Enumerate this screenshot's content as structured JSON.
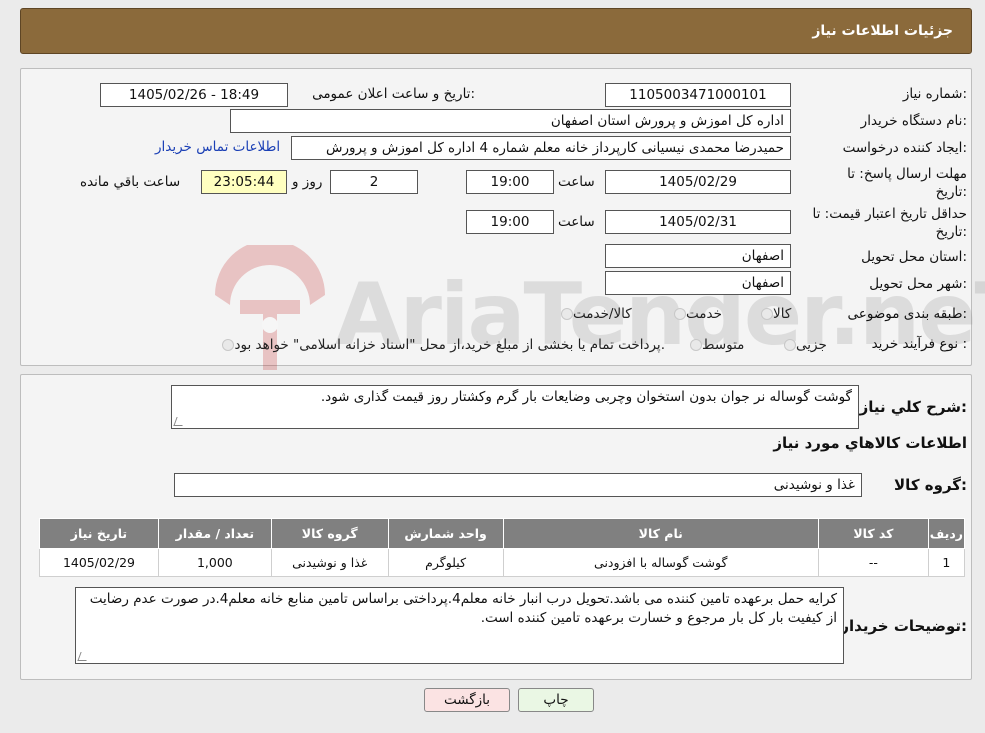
{
  "header": {
    "title": "جزئیات اطلاعات نیاز"
  },
  "watermark": {
    "text": "AriaTender.neT"
  },
  "form": {
    "need_number": {
      "label": "شماره نیاز:",
      "value": "1105003471000101"
    },
    "announce": {
      "label": "تاریخ و ساعت اعلان عمومی:",
      "value": "1405/02/26 - 18:49"
    },
    "buyer_org": {
      "label": "نام دستگاه خریدار:",
      "value": "اداره کل اموزش و پرورش استان اصفهان"
    },
    "requester": {
      "label": "ایجاد کننده درخواست:",
      "value": "حمیدرضا محمدی نیسیانی کارپرداز خانه معلم شماره 4 اداره کل اموزش و پرورش",
      "contact_link": "اطلاعات تماس خریدار"
    },
    "deadline": {
      "label_line1": "مهلت ارسال پاسخ: تا",
      "label_line2": "تاریخ:",
      "date": "1405/02/29",
      "time_label": "ساعت",
      "time": "19:00",
      "days": "2",
      "days_label": "روز و",
      "remaining": "23:05:44",
      "remaining_label": "ساعت باقي مانده"
    },
    "min_validity": {
      "label_line1": "حداقل تاریخ اعتبار قیمت: تا",
      "label_line2": "تاریخ:",
      "date": "1405/02/31",
      "time_label": "ساعت",
      "time": "19:00"
    },
    "province": {
      "label": "استان محل تحویل:",
      "value": "اصفهان"
    },
    "city": {
      "label": "شهر محل تحویل:",
      "value": "اصفهان"
    },
    "category": {
      "label": "طبقه بندی موضوعی:",
      "options": [
        "کالا",
        "خدمت",
        "کالا/خدمت"
      ]
    },
    "process": {
      "label": "نوع فرآیند خرید :",
      "options": [
        "جزیی",
        "متوسط"
      ],
      "note": "پرداخت تمام یا بخشی از مبلغ خرید،از محل \"اسناد خزانه اسلامی\" خواهد بود."
    }
  },
  "description": {
    "label": "شرح کلي نياز:",
    "value": "گوشت گوساله نر جوان بدون استخوان وچربی  وضایعات بار گرم وکشتار روز قیمت گذاری شود."
  },
  "goods": {
    "title": "اطلاعات کالاهاي مورد نياز",
    "group_label": "گروه کالا:",
    "group_value": "غذا و نوشیدنی",
    "columns": [
      "رديف",
      "کد کالا",
      "نام کالا",
      "واحد شمارش",
      "گروه کالا",
      "تعداد / مقدار",
      "تاریخ نیاز"
    ],
    "rows": [
      [
        "1",
        "--",
        "گوشت گوساله با افزودنی",
        "کیلوگرم",
        "غذا و نوشیدنی",
        "1,000",
        "1405/02/29"
      ]
    ]
  },
  "buyer_notes": {
    "label": "توضیحات خریدار:",
    "value": "کرایه حمل برعهده تامین کننده می باشد.تحویل درب انبار خانه معلم4.پرداختی براساس تامین منابع خانه معلم4.در صورت عدم رضایت از کیفیت بار کل بار مرجوع و خسارت برعهده تامین کننده است."
  },
  "buttons": {
    "print": "چاپ",
    "back": "بازگشت"
  },
  "colors": {
    "header_bg": "#8b6a3b",
    "table_header_bg": "#808080",
    "back_button_bg": "#fbe3e3",
    "print_button_bg": "#eaf7e4",
    "remaining_bg": "#ffffc0",
    "link": "#1a3fb5"
  }
}
